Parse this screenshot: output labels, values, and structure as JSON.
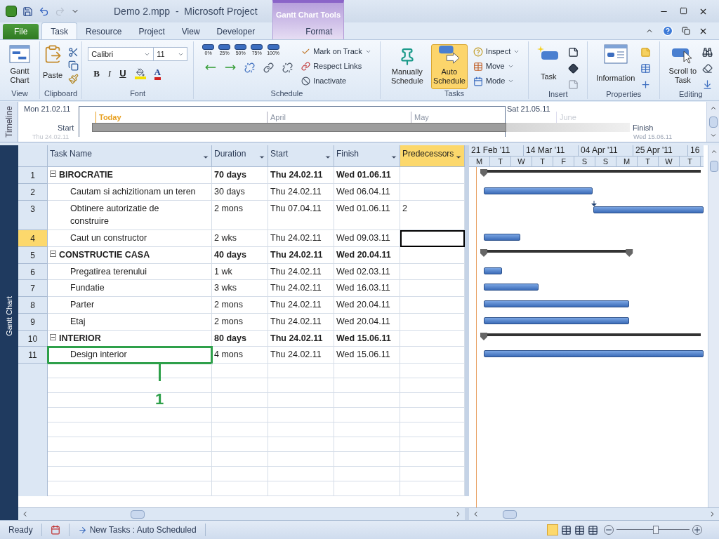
{
  "title_bar": {
    "title": "Demo 2.mpp  -  Microsoft Project",
    "context_tab": "Gantt Chart Tools"
  },
  "tabs": [
    {
      "label": "File",
      "kind": "file",
      "selected": false
    },
    {
      "label": "Task",
      "kind": "tab",
      "selected": true
    },
    {
      "label": "Resource",
      "kind": "tab",
      "selected": false
    },
    {
      "label": "Project",
      "kind": "tab",
      "selected": false
    },
    {
      "label": "View",
      "kind": "tab",
      "selected": false
    },
    {
      "label": "Developer",
      "kind": "tab",
      "selected": false
    },
    {
      "label": "Format",
      "kind": "contextual",
      "selected": false
    }
  ],
  "ribbon": [
    {
      "kind": "view",
      "label": "View",
      "button": "Gantt Chart"
    },
    {
      "kind": "clipboard",
      "label": "Clipboard",
      "button": "Paste"
    },
    {
      "kind": "font",
      "label": "Font",
      "font": "Calibri",
      "size": "11",
      "bold": "B",
      "italic": "I",
      "underline": "U",
      "color_letter": "A"
    },
    {
      "kind": "schedule",
      "label": "Schedule",
      "percents": [
        "0%",
        "25%",
        "50%",
        "75%",
        "100%"
      ],
      "commands": [
        "Mark on Track",
        "Respect Links",
        "Inactivate"
      ]
    },
    {
      "kind": "tasks",
      "label": "Tasks",
      "modes": [
        {
          "label": "Manually Schedule",
          "selected": false
        },
        {
          "label": "Auto Schedule",
          "selected": true
        }
      ],
      "commands": [
        "Inspect",
        "Move",
        "Mode"
      ]
    },
    {
      "kind": "insert",
      "label": "Insert",
      "button": "Task"
    },
    {
      "kind": "properties",
      "label": "Properties",
      "button": "Information"
    },
    {
      "kind": "editing",
      "label": "Editing",
      "button": "Scroll to Task"
    }
  ],
  "timeline": {
    "label": "Timeline",
    "range_start": "Mon 21.02.11",
    "range_end": "Sat 21.05.11",
    "today": "Today",
    "months": [
      "April",
      "May",
      "June"
    ],
    "start": "Start",
    "finish": "Finish",
    "start_date": "Thu 24.02.11",
    "finish_date": "Wed 15.06.11"
  },
  "side_label": "Gantt Chart",
  "table": {
    "columns": [
      "Task Name",
      "Duration",
      "Start",
      "Finish",
      "Predecessors"
    ],
    "tasks": [
      {
        "id": "1",
        "name": "BIROCRATIE",
        "duration": "70 days",
        "start": "Thu 24.02.11",
        "finish": "Wed 01.06.11",
        "selected": false,
        "annotated": false,
        "expanded": true,
        "children": [
          {
            "id": "2",
            "name": "Cautam si achizitionam un teren",
            "duration": "30 days",
            "start": "Thu 24.02.11",
            "finish": "Wed 06.04.11",
            "selected": false,
            "annotated": false
          },
          {
            "id": "3",
            "name": "Obtinere autorizatie de construire",
            "duration": "2 mons",
            "start": "Thu 07.04.11",
            "finish": "Wed 01.06.11",
            "predecessors": "2",
            "selected": false,
            "annotated": false
          },
          {
            "id": "4",
            "name": "Caut un constructor",
            "duration": "2 wks",
            "start": "Thu 24.02.11",
            "finish": "Wed 09.03.11",
            "selected": true,
            "annotated": false
          }
        ]
      },
      {
        "id": "5",
        "name": "CONSTRUCTIE CASA",
        "duration": "40 days",
        "start": "Thu 24.02.11",
        "finish": "Wed 20.04.11",
        "selected": false,
        "annotated": false,
        "expanded": true,
        "children": [
          {
            "id": "6",
            "name": "Pregatirea terenului",
            "duration": "1 wk",
            "start": "Thu 24.02.11",
            "finish": "Wed 02.03.11",
            "selected": false,
            "annotated": false
          },
          {
            "id": "7",
            "name": "Fundatie",
            "duration": "3 wks",
            "start": "Thu 24.02.11",
            "finish": "Wed 16.03.11",
            "selected": false,
            "annotated": false
          },
          {
            "id": "8",
            "name": "Parter",
            "duration": "2 mons",
            "start": "Thu 24.02.11",
            "finish": "Wed 20.04.11",
            "selected": false,
            "annotated": false
          },
          {
            "id": "9",
            "name": "Etaj",
            "duration": "2 mons",
            "start": "Thu 24.02.11",
            "finish": "Wed 20.04.11",
            "selected": false,
            "annotated": false
          }
        ]
      },
      {
        "id": "10",
        "name": "INTERIOR",
        "duration": "80 days",
        "start": "Thu 24.02.11",
        "finish": "Wed 15.06.11",
        "selected": false,
        "annotated": false,
        "expanded": true,
        "children": [
          {
            "id": "11",
            "name": "Design interior",
            "duration": "4 mons",
            "start": "Thu 24.02.11",
            "finish": "Wed 15.06.11",
            "selected": false,
            "annotated": true
          }
        ]
      }
    ]
  },
  "chart_header": {
    "weeks": [
      "21 Feb '11",
      "14 Mar '11",
      "04 Apr '11",
      "25 Apr '11",
      "16"
    ],
    "days": [
      "M",
      "T",
      "W",
      "T",
      "F",
      "S",
      "S",
      "M",
      "T",
      "W",
      "T"
    ]
  },
  "annotation": {
    "label": "1"
  },
  "status_bar": {
    "state": "Ready",
    "mode": "New Tasks : Auto Scheduled",
    "zoom": {
      "level": 0.54
    }
  }
}
